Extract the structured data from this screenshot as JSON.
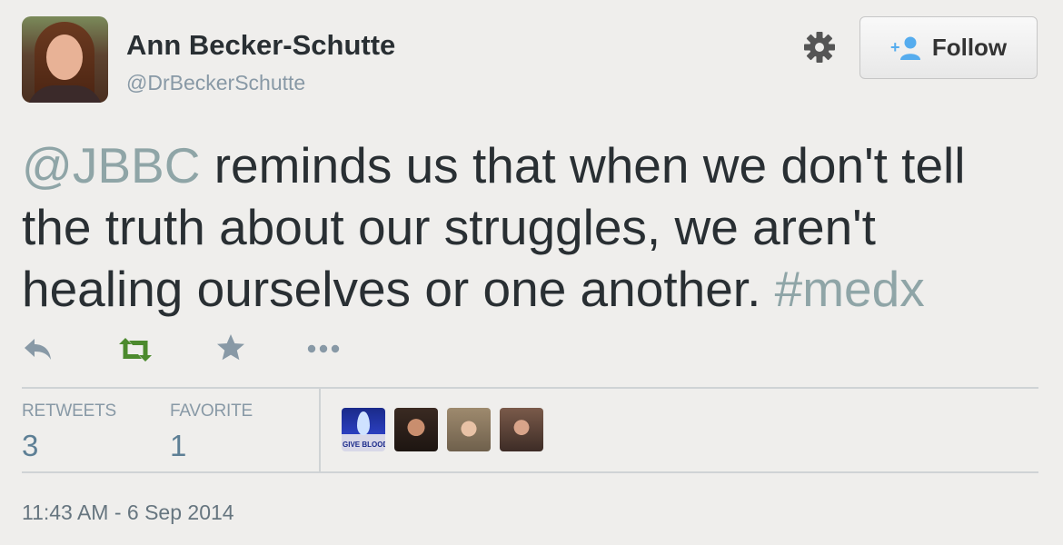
{
  "header": {
    "display_name": "Ann Becker-Schutte",
    "handle": "@DrBeckerSchutte",
    "follow_label": "Follow"
  },
  "tweet": {
    "mention": "@JBBC",
    "text_main": " reminds us that when we don't tell the truth about our struggles, we aren't healing ourselves or one another.  ",
    "hashtag": "#medx"
  },
  "actions": {
    "icons": [
      "reply-icon",
      "retweet-icon",
      "favorite-star-icon",
      "more-icon"
    ]
  },
  "stats": {
    "retweets_label": "RETWEETS",
    "retweets_count": "3",
    "favorites_label": "FAVORITE",
    "favorites_count": "1"
  },
  "engagers": {
    "first_badge_text": "GIVE BLOOD"
  },
  "timestamp": "11:43 AM - 6 Sep 2014",
  "colors": {
    "background": "#efeeec",
    "link": "#8fa5a7",
    "retweet_green": "#4c8a2e",
    "muted": "#8899a6"
  }
}
